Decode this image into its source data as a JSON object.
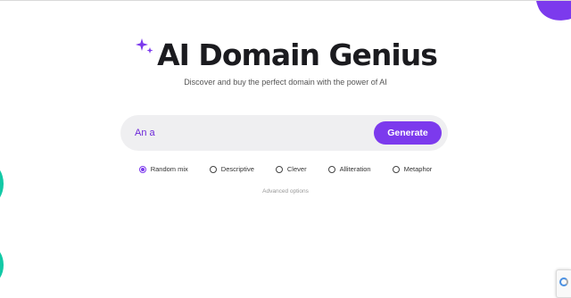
{
  "header": {
    "title": "AI Domain Genius",
    "subtitle": "Discover and buy the perfect domain with the power of AI"
  },
  "search": {
    "value": "An a",
    "button_label": "Generate"
  },
  "options": [
    {
      "label": "Random mix",
      "selected": true
    },
    {
      "label": "Descriptive",
      "selected": false
    },
    {
      "label": "Clever",
      "selected": false
    },
    {
      "label": "Alliteration",
      "selected": false
    },
    {
      "label": "Metaphor",
      "selected": false
    }
  ],
  "advanced_label": "Advanced options",
  "colors": {
    "accent": "#7c3aed",
    "teal": "#12c9a6",
    "input_bg": "#efeff1"
  },
  "icons": {
    "sparkle": "sparkle-icon",
    "recaptcha": "recaptcha-icon"
  }
}
